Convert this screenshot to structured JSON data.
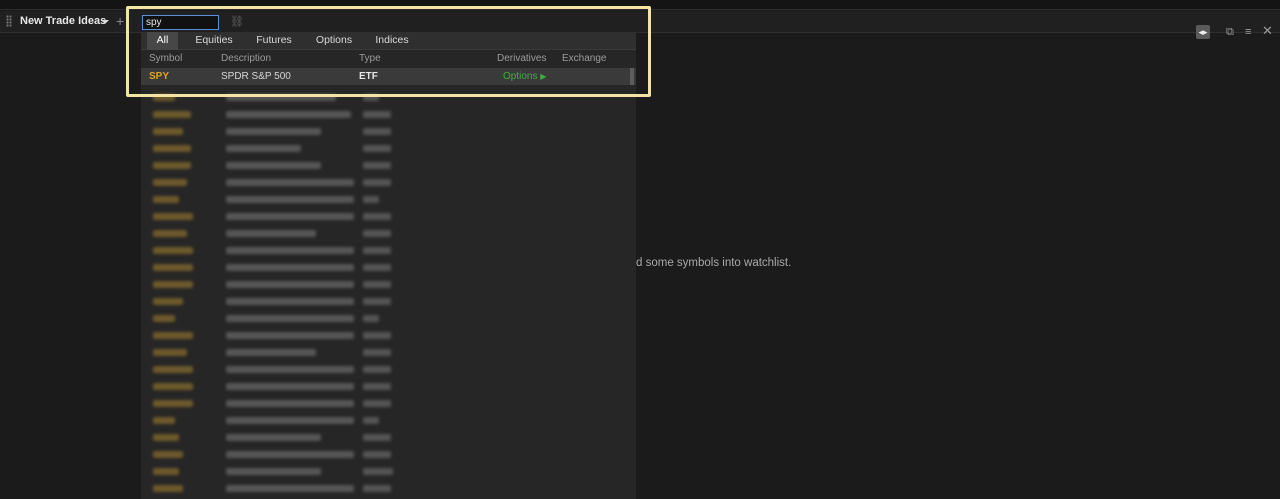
{
  "window": {
    "title": "New Trade Ideas",
    "search_value": "spy",
    "empty_message": "d some symbols into watchlist."
  },
  "search_dropdown": {
    "tabs": [
      {
        "label": "All",
        "active": true
      },
      {
        "label": "Equities",
        "active": false
      },
      {
        "label": "Futures",
        "active": false
      },
      {
        "label": "Options",
        "active": false
      },
      {
        "label": "Indices",
        "active": false
      }
    ],
    "columns": [
      "Symbol",
      "Description",
      "Type",
      "Derivatives",
      "Exchange"
    ],
    "result": {
      "symbol": "SPY",
      "description": "SPDR S&P 500",
      "type": "ETF",
      "derivatives": "Options",
      "exchange": ""
    }
  },
  "colors": {
    "accent_symbol": "#e0a12a",
    "derivatives_link": "#3fae3f",
    "highlight_border": "#f3e4a6",
    "input_border": "#5b8fd6"
  },
  "icons": {
    "grip": "drag-grip-icon",
    "caret": "caret-down-icon",
    "add": "plus-icon",
    "link": "link-icon",
    "toggle": "split-view-icon",
    "popout": "popout-icon",
    "menu": "menu-icon",
    "close": "close-icon"
  }
}
